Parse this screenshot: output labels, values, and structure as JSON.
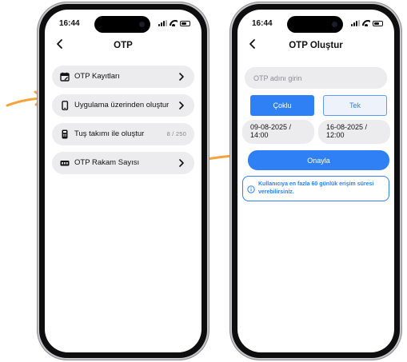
{
  "status_bar": {
    "time": "16:44"
  },
  "left_screen": {
    "title": "OTP",
    "menu": [
      {
        "label": "OTP Kayıtları",
        "icon": "calendar-edit-icon",
        "trailing": "chevron"
      },
      {
        "label": "Uygulama üzerinden oluştur",
        "icon": "phone-icon",
        "trailing": "chevron"
      },
      {
        "label": "Tuş takımı ile oluştur",
        "icon": "keypad-device-icon",
        "trailing": "count",
        "count": "8 / 250"
      },
      {
        "label": "OTP Rakam Sayısı",
        "icon": "digits-icon",
        "trailing": "chevron"
      }
    ]
  },
  "right_screen": {
    "title": "OTP Oluştur",
    "name_input": {
      "placeholder": "OTP adını girin",
      "value": ""
    },
    "segments": {
      "multi": "Çoklu",
      "single": "Tek",
      "selected": "multi"
    },
    "start_date": {
      "date": "09-08-2025 /",
      "time": "14:00"
    },
    "end_date": {
      "date": "16-08-2025 /",
      "time": "12:00"
    },
    "confirm_label": "Onayla",
    "info_text": "Kullanıcıya en fazla 60 günlük erişim süresi verebilirsiniz."
  },
  "colors": {
    "accent": "#2f80f5",
    "arrow": "#f5a23a",
    "pill_bg": "#ececee"
  }
}
